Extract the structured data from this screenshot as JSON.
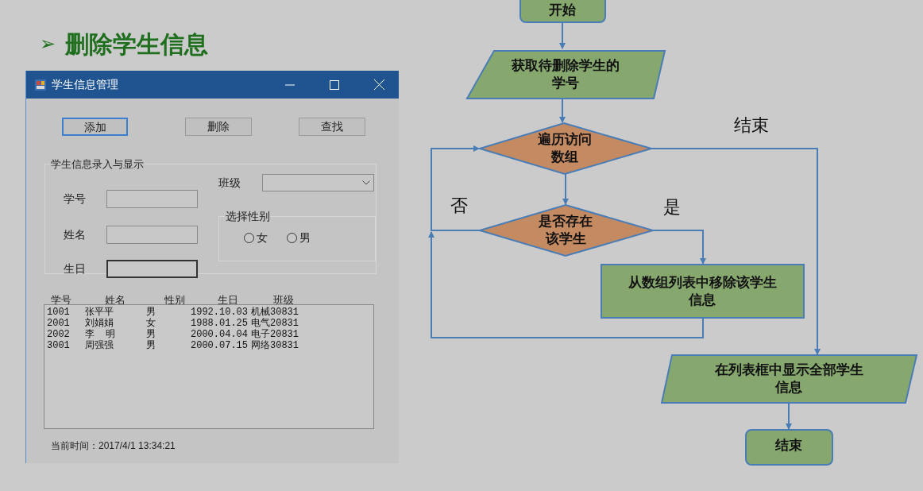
{
  "slide_title": {
    "bullet": "➢",
    "text": "删除学生信息"
  },
  "window": {
    "title": "学生信息管理",
    "buttons": [
      {
        "label": "添加",
        "focused": true
      },
      {
        "label": "删除",
        "focused": false
      },
      {
        "label": "查找",
        "focused": false
      }
    ],
    "group": {
      "title": "学生信息录入与显示",
      "fields": [
        {
          "label": "学号",
          "focused": false
        },
        {
          "label": "姓名",
          "focused": false
        },
        {
          "label": "生日",
          "focused": true
        }
      ],
      "class_field": {
        "label": "班级"
      },
      "gender_group": {
        "title": "选择性别",
        "options": [
          {
            "label": "女",
            "selected": false
          },
          {
            "label": "男",
            "selected": false
          }
        ]
      }
    },
    "list": {
      "columns": [
        "学号",
        "姓名",
        "性别",
        "生日",
        "班级"
      ],
      "rows": [
        [
          "1001",
          "张平平",
          "男",
          "1992.10.03",
          "机械30831"
        ],
        [
          "2001",
          "刘娟娟",
          "女",
          "1988.01.25",
          "电气20831"
        ],
        [
          "2002",
          "李  明",
          "男",
          "2000.04.04",
          "电子20831"
        ],
        [
          "3001",
          "周强强",
          "男",
          "2000.07.15",
          "网络30831"
        ]
      ]
    },
    "status": "当前时间：2017/4/1 13:34:21"
  },
  "flowchart": {
    "nodes": [
      {
        "kind": "terminal",
        "text": "开始"
      },
      {
        "kind": "io",
        "text": "获取待删除学生的学号"
      },
      {
        "kind": "decision",
        "text": "遍历访问数组"
      },
      {
        "kind": "decision",
        "text": "是否存在该学生"
      },
      {
        "kind": "process",
        "text": "从数组列表中移除该学生信息"
      },
      {
        "kind": "io",
        "text": "在列表框中显示全部学生信息"
      },
      {
        "kind": "terminal",
        "text": "结束"
      }
    ],
    "edge_labels": [
      "结束",
      "否",
      "是"
    ]
  }
}
